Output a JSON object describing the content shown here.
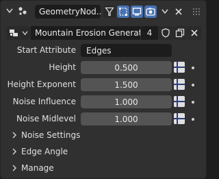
{
  "header": {
    "tree_name": "GeometryNod...",
    "chevron_icon": "chevron-down-icon",
    "modifier_icon": "geometry-nodes-icon",
    "toggles": [
      "filter-icon",
      "edit-mode-icon",
      "viewport-icon",
      "render-icon"
    ],
    "close_icon": "close-icon"
  },
  "datablock": {
    "name": "Mountain Erosion Generator",
    "users": "4",
    "icons": [
      "node-tree-icon",
      "shield-icon",
      "duplicate-icon",
      "delete-icon"
    ]
  },
  "inputs": {
    "start_attribute": {
      "label": "Start Attribute",
      "value": "Edges"
    },
    "rows": [
      {
        "label": "Height",
        "value": "0.500"
      },
      {
        "label": "Height Exponent",
        "value": "1.500"
      },
      {
        "label": "Noise Influence",
        "value": "1.000"
      },
      {
        "label": "Noise Midlevel",
        "value": "1.000"
      }
    ]
  },
  "panels": [
    {
      "label": "Noise Settings"
    },
    {
      "label": "Edge Angle"
    },
    {
      "label": "Manage"
    }
  ],
  "colors": {
    "accent": "#4772b3",
    "panel": "#303030",
    "field": "#545454",
    "dark_field": "#1c1c1c"
  }
}
